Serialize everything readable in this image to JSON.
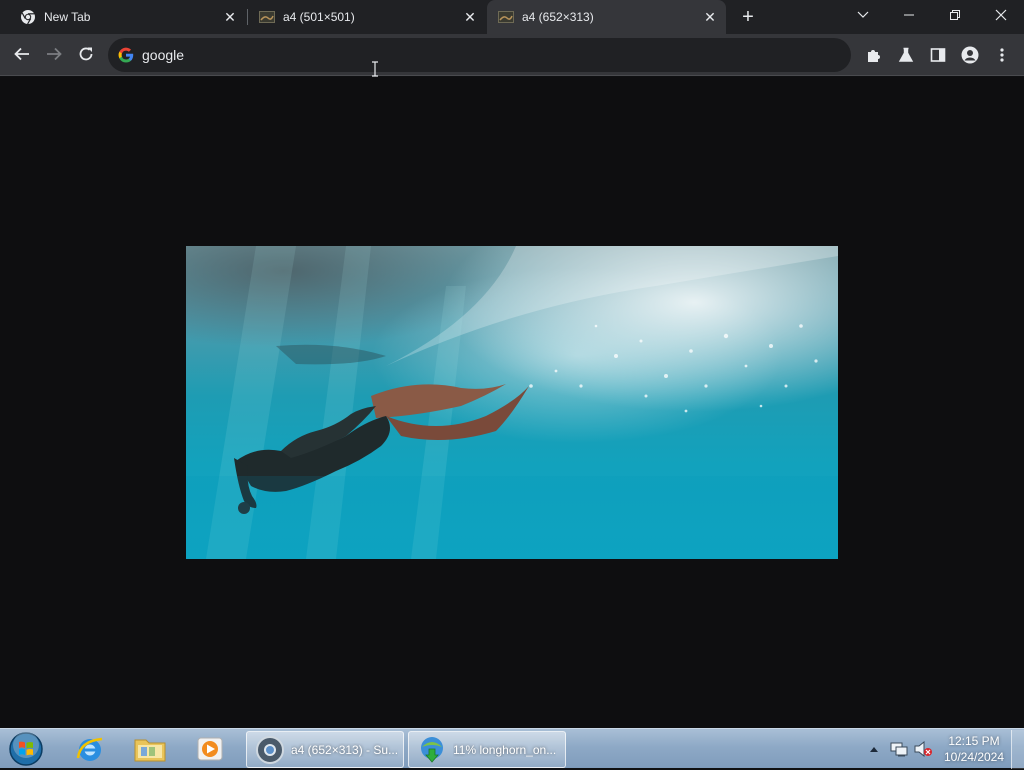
{
  "browser": {
    "tabs": [
      {
        "title": "New Tab",
        "icon": "chrome-icon",
        "active": false
      },
      {
        "title": "a4 (501×501)",
        "icon": "image-thumbnail-icon",
        "active": false
      },
      {
        "title": "a4 (652×313)",
        "icon": "image-thumbnail-icon",
        "active": true
      }
    ],
    "new_tab_symbol": "+",
    "close_symbol": "✕",
    "omnibox": {
      "value": "google",
      "icon": "google-g-icon"
    },
    "toolbar_icons": [
      "back-icon",
      "forward-icon",
      "reload-icon",
      "extensions-icon",
      "labs-flask-icon",
      "side-panel-icon",
      "profile-icon",
      "menu-icon"
    ],
    "window_controls": [
      "tab-search-chevron-icon",
      "minimize-icon",
      "restore-icon",
      "close-window-icon"
    ]
  },
  "content": {
    "image_description_icon": "underwater-freediver-photo",
    "background": "#0e0e10"
  },
  "taskbar": {
    "pinned": [
      "start-orb-icon",
      "internet-explorer-icon",
      "file-explorer-icon",
      "media-player-icon"
    ],
    "tasks": [
      {
        "label": "a4 (652×313) - Su...",
        "icon": "chrome-icon"
      },
      {
        "label": "11% longhorn_on...",
        "icon": "download-manager-icon"
      }
    ],
    "tray_icons": [
      "show-hidden-icons-arrow",
      "network-icon",
      "volume-muted-icon"
    ],
    "clock": {
      "time": "12:15 PM",
      "date": "10/24/2024"
    }
  },
  "colors": {
    "tabstrip": "#202124",
    "toolbar": "#35363a",
    "omnibox": "#202124",
    "text": "#e8eaed",
    "taskbar": "#8ea9c6"
  }
}
